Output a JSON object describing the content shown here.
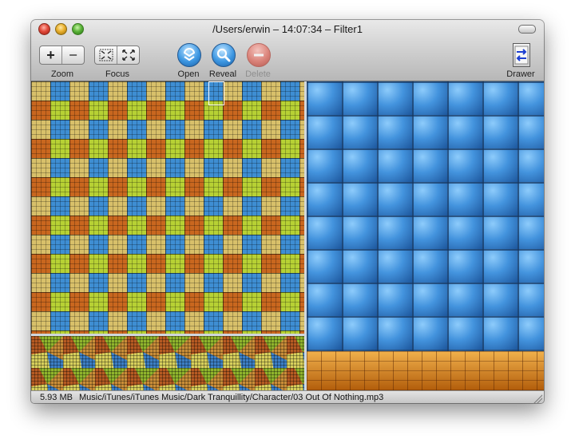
{
  "window": {
    "title": "/Users/erwin – 14:07:34 – Filter1"
  },
  "toolbar": {
    "zoom": {
      "label": "Zoom",
      "in_symbol": "+",
      "out_symbol": "−"
    },
    "focus": {
      "label": "Focus"
    },
    "open": {
      "label": "Open",
      "icon": "open-icon"
    },
    "reveal": {
      "label": "Reveal",
      "icon": "magnifier-icon"
    },
    "delete": {
      "label": "Delete",
      "icon": "minus-icon",
      "enabled": false
    },
    "drawer": {
      "label": "Drawer",
      "icon": "drawer-arrows-icon"
    }
  },
  "treemap": {
    "colors": {
      "blue": "#3f8fd8",
      "orange": "#c77d18",
      "olive": "#b7d134",
      "rust": "#c9671f",
      "brown": "#7a4c23",
      "tan": "#d8c06a"
    }
  },
  "status": {
    "size": "5.93 MB",
    "path": "Music/iTunes/iTunes Music/Dark Tranquillity/Character/03 Out Of Nothing.mp3"
  }
}
